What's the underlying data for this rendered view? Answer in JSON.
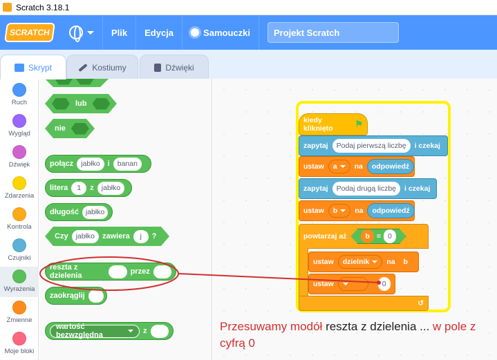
{
  "window": {
    "title": "Scratch 3.18.1"
  },
  "menubar": {
    "logo": "SCRATCH",
    "file": "Plik",
    "edit": "Edycja",
    "tutorials": "Samouczki",
    "project_title": "Projekt Scratch"
  },
  "tabs": [
    {
      "label": "Skrypt",
      "active": true
    },
    {
      "label": "Kostiumy",
      "active": false
    },
    {
      "label": "Dźwięki",
      "active": false
    }
  ],
  "categories": [
    {
      "label": "Ruch",
      "color": "#4c97ff"
    },
    {
      "label": "Wygląd",
      "color": "#9966ff"
    },
    {
      "label": "Dźwięk",
      "color": "#cf63cf"
    },
    {
      "label": "Zdarzenia",
      "color": "#ffd500"
    },
    {
      "label": "Kontrola",
      "color": "#ffab19"
    },
    {
      "label": "Czujniki",
      "color": "#5cb1d6"
    },
    {
      "label": "Wyrażenia",
      "color": "#59c059",
      "selected": true
    },
    {
      "label": "Zmienne",
      "color": "#ff8c1a"
    },
    {
      "label": "Moje bloki",
      "color": "#ff6680"
    }
  ],
  "palette": {
    "or_label": "lub",
    "not_label": "nie",
    "join": {
      "label": "połącz",
      "a": "jabłko",
      "b": "banan"
    },
    "letter": {
      "label": "litera",
      "n": "1",
      "of": "z",
      "word": "jabłko"
    },
    "length": {
      "label": "długość",
      "word": "jabłko"
    },
    "contains": {
      "prefix": "Czy",
      "word": "jabłko",
      "mid": "zawiera",
      "letter": "j",
      "suffix": "?"
    },
    "mod": {
      "label": "reszta z dzielenia",
      "by": "przez"
    },
    "round": {
      "label": "zaokrąglij"
    },
    "abs": {
      "label": "wartość bezwzględna",
      "of": "z"
    }
  },
  "script": {
    "hat": "kiedy kliknięto",
    "ask1": {
      "label": "zapytaj",
      "text": "Podaj pierwszą liczbę",
      "wait": "i czekaj"
    },
    "set1": {
      "label": "ustaw",
      "var": "a",
      "to": "na",
      "value": "odpowiedź"
    },
    "ask2": {
      "label": "zapytaj",
      "text": "Podaj drugą liczbę",
      "wait": "i czekaj"
    },
    "set2": {
      "label": "ustaw",
      "var": "b",
      "to": "na",
      "value": "odpowiedź"
    },
    "repeat": {
      "label": "powtarzaj aż",
      "left": "b",
      "op": "=",
      "right": "0"
    },
    "set3": {
      "label": "ustaw",
      "var": "dzielnik",
      "to": "na",
      "value": "b"
    },
    "set4": {
      "label": "ustaw",
      "value": "0"
    },
    "loop_arrow": "↺"
  },
  "annotation": {
    "part1": "Przesuwamy modół ",
    "part2": "reszta z dzielenia ... ",
    "part3": "w pole z cyfrą 0"
  },
  "colors": {
    "menubar": "#4c97ff",
    "operators": "#59c059",
    "annotation": "#d32f2f"
  }
}
